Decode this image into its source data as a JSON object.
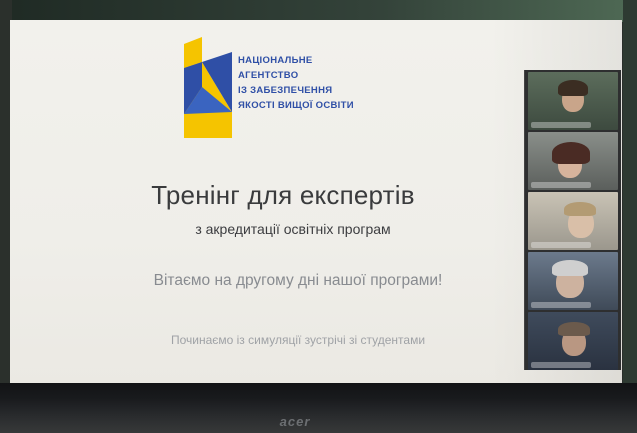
{
  "logo": {
    "lines": [
      "НАЦІОНАЛЬНЕ",
      "АГЕНТСТВО",
      "ІЗ ЗАБЕЗПЕЧЕННЯ",
      "ЯКОСТІ ВИЩОЇ ОСВІТИ"
    ],
    "colors": {
      "blue": "#2f4fa6",
      "yellow": "#f5c400"
    }
  },
  "slide": {
    "title": "Тренінг для експертів",
    "subtitle": "з акредитації освітніх програм",
    "welcome": "Вітаємо на другому дні нашої програми!",
    "start": "Починаємо із симуляції зустрічі зі студентами"
  },
  "monitor": {
    "brand": "acer"
  },
  "participants": {
    "count": 5
  }
}
